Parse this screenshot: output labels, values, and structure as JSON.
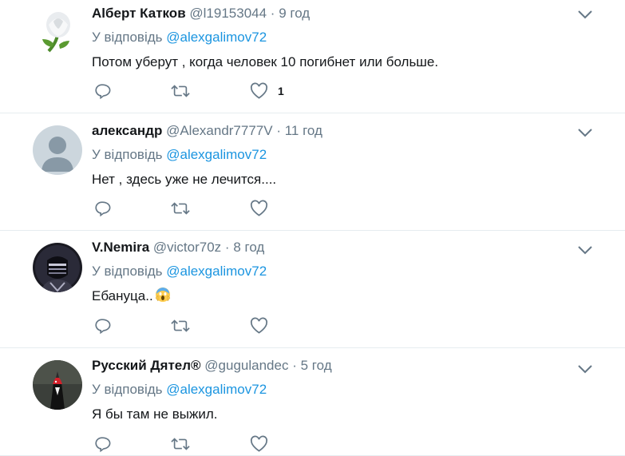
{
  "tweets": [
    {
      "name": "Alберт Катков",
      "handle": "@l19153044",
      "dot": "·",
      "time": "9 год",
      "reply_prefix": "У відповідь",
      "reply_mention": "@alexgalimov72",
      "text": "Потом уберут , когда человек 10 погибнет или больше.",
      "likes": "1",
      "avatar_icon": "white-rose-avatar"
    },
    {
      "name": "александр",
      "handle": "@Alexandr7777V",
      "dot": "·",
      "time": "11 год",
      "reply_prefix": "У відповідь",
      "reply_mention": "@alexgalimov72",
      "text": "Нет , здесь уже не лечится....",
      "likes": "",
      "avatar_icon": "default-user-avatar"
    },
    {
      "name": "V.Nemira",
      "handle": "@victor70z",
      "dot": "·",
      "time": "8 год",
      "reply_prefix": "У відповідь",
      "reply_mention": "@alexgalimov72",
      "text": "Ебануца..",
      "likes": "",
      "avatar_icon": "masked-figure-avatar"
    },
    {
      "name": "Русский Дятел®",
      "handle": "@gugulandec",
      "dot": "·",
      "time": "5 год",
      "reply_prefix": "У відповідь",
      "reply_mention": "@alexgalimov72",
      "text": "Я бы там не выжил.",
      "likes": "",
      "avatar_icon": "woodpecker-avatar"
    }
  ],
  "icons": {
    "reply": "reply-icon",
    "retweet": "retweet-icon",
    "like": "heart-icon",
    "menu": "chevron-down-icon",
    "emoji": "screaming-face-emoji"
  },
  "colors": {
    "text": "#14171a",
    "secondary": "#657786",
    "link": "#1b95e0",
    "divider": "#e6ecf0"
  }
}
